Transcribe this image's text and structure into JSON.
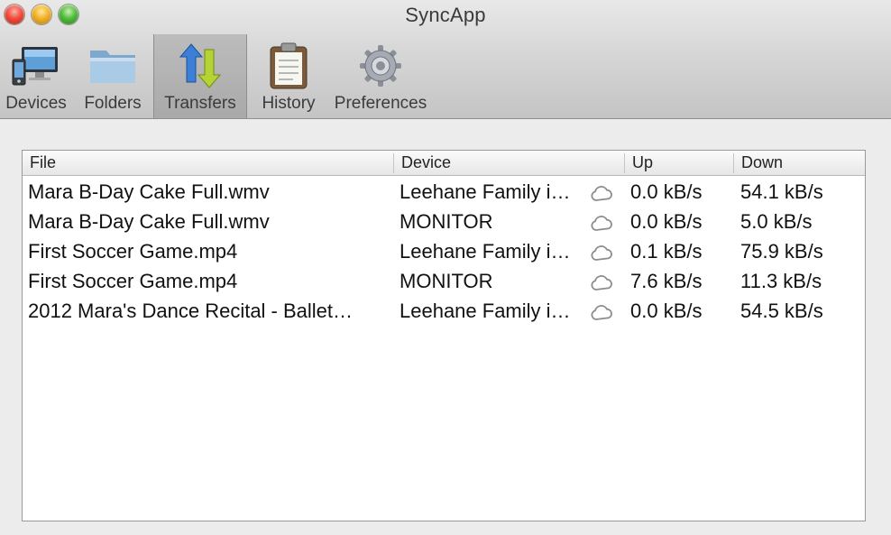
{
  "window": {
    "title": "SyncApp"
  },
  "toolbar": {
    "items": [
      {
        "label": "Devices",
        "icon": "devices-icon"
      },
      {
        "label": "Folders",
        "icon": "folder-icon"
      },
      {
        "label": "Transfers",
        "icon": "transfers-icon",
        "selected": true
      },
      {
        "label": "History",
        "icon": "clipboard-icon"
      },
      {
        "label": "Preferences",
        "icon": "gear-icon"
      }
    ]
  },
  "table": {
    "columns": [
      "File",
      "Device",
      "Up",
      "Down"
    ],
    "rows": [
      {
        "file": "Mara B-Day Cake Full.wmv",
        "device": "Leehane Family i…",
        "up": "0.0 kB/s",
        "down": "54.1 kB/s"
      },
      {
        "file": "Mara B-Day Cake Full.wmv",
        "device": "MONITOR",
        "up": "0.0 kB/s",
        "down": "5.0 kB/s"
      },
      {
        "file": "First Soccer Game.mp4",
        "device": "Leehane Family i…",
        "up": "0.1 kB/s",
        "down": "75.9 kB/s"
      },
      {
        "file": "First Soccer Game.mp4",
        "device": "MONITOR",
        "up": "7.6 kB/s",
        "down": "11.3 kB/s"
      },
      {
        "file": "2012 Mara's Dance Recital - Ballet…",
        "device": "Leehane Family i…",
        "up": "0.0 kB/s",
        "down": "54.5 kB/s"
      }
    ],
    "row_icon": "cloud-icon"
  }
}
